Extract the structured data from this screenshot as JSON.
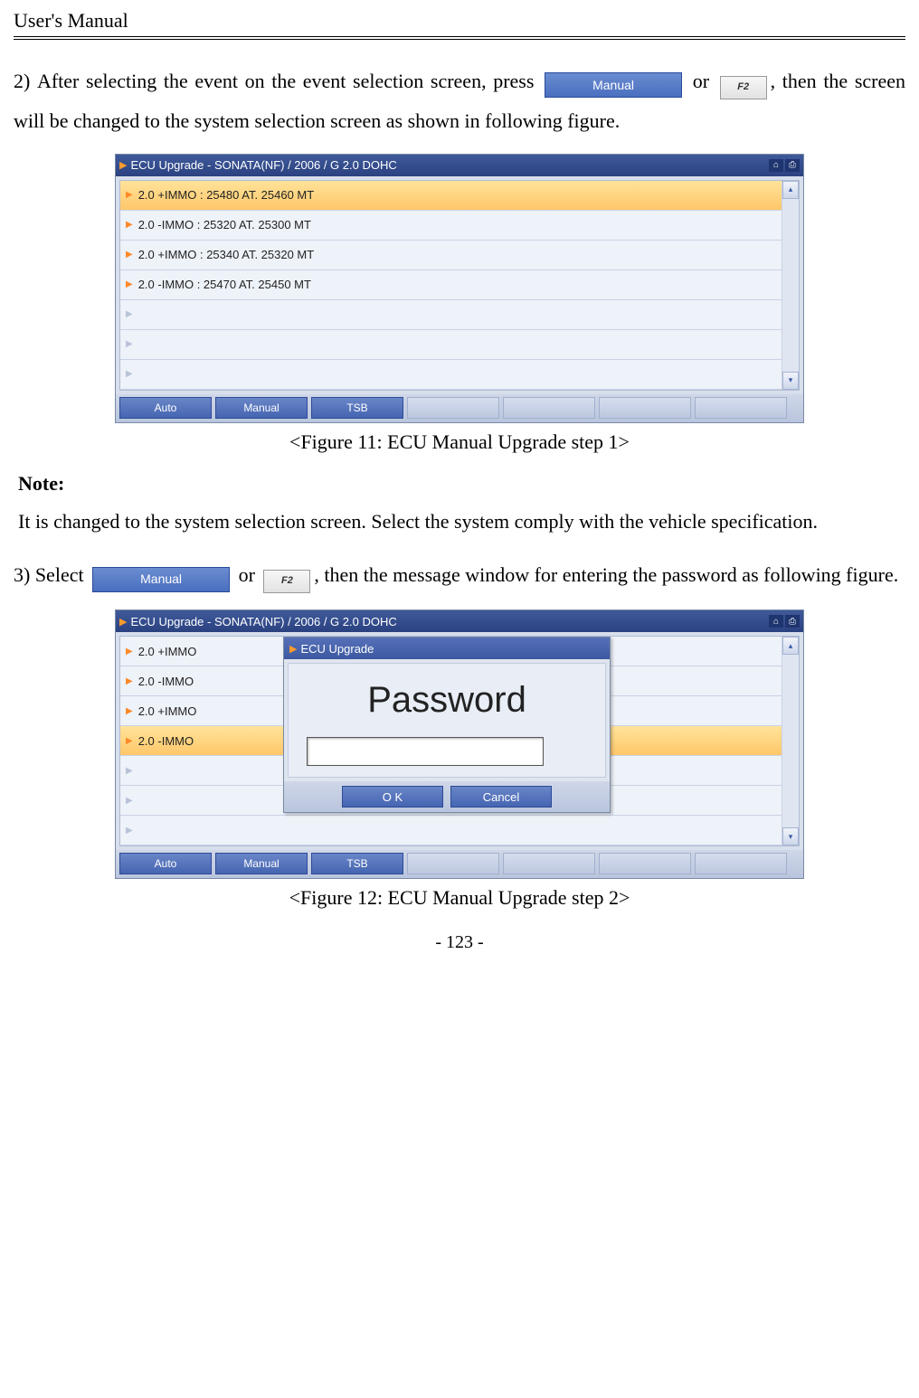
{
  "header": "User's Manual",
  "step2": {
    "prefix": "2) After selecting the event on the event selection screen, press",
    "mid": "or",
    "suffix": ", then the screen will be changed to the system selection screen as shown in following figure."
  },
  "manual_btn_label": "Manual",
  "f2_btn_label": "F2",
  "app": {
    "title": "ECU Upgrade - SONATA(NF) / 2006 / G 2.0 DOHC",
    "rows": [
      "2.0 +IMMO : 25480 AT. 25460 MT",
      "2.0 -IMMO : 25320 AT. 25300 MT",
      "2.0 +IMMO : 25340 AT. 25320 MT",
      "2.0 -IMMO : 25470 AT. 25450 MT"
    ],
    "rows_short": [
      "2.0 +IMMO",
      "2.0 -IMMO",
      "2.0 +IMMO",
      "2.0 -IMMO"
    ],
    "bottom": [
      "Auto",
      "Manual",
      "TSB"
    ]
  },
  "caption1": "<Figure 11: ECU Manual Upgrade step 1>",
  "note_label": "Note:",
  "note_text": "It is changed to the system selection screen. Select the system comply with the vehicle specification.",
  "step3": {
    "prefix": "3) Select",
    "mid": "or",
    "suffix": ", then the message window for entering the password as following figure."
  },
  "modal": {
    "title": "ECU Upgrade",
    "label": "Password",
    "ok": "O K",
    "cancel": "Cancel"
  },
  "caption2": "<Figure 12: ECU Manual Upgrade step 2>",
  "page_num": "- 123 -"
}
